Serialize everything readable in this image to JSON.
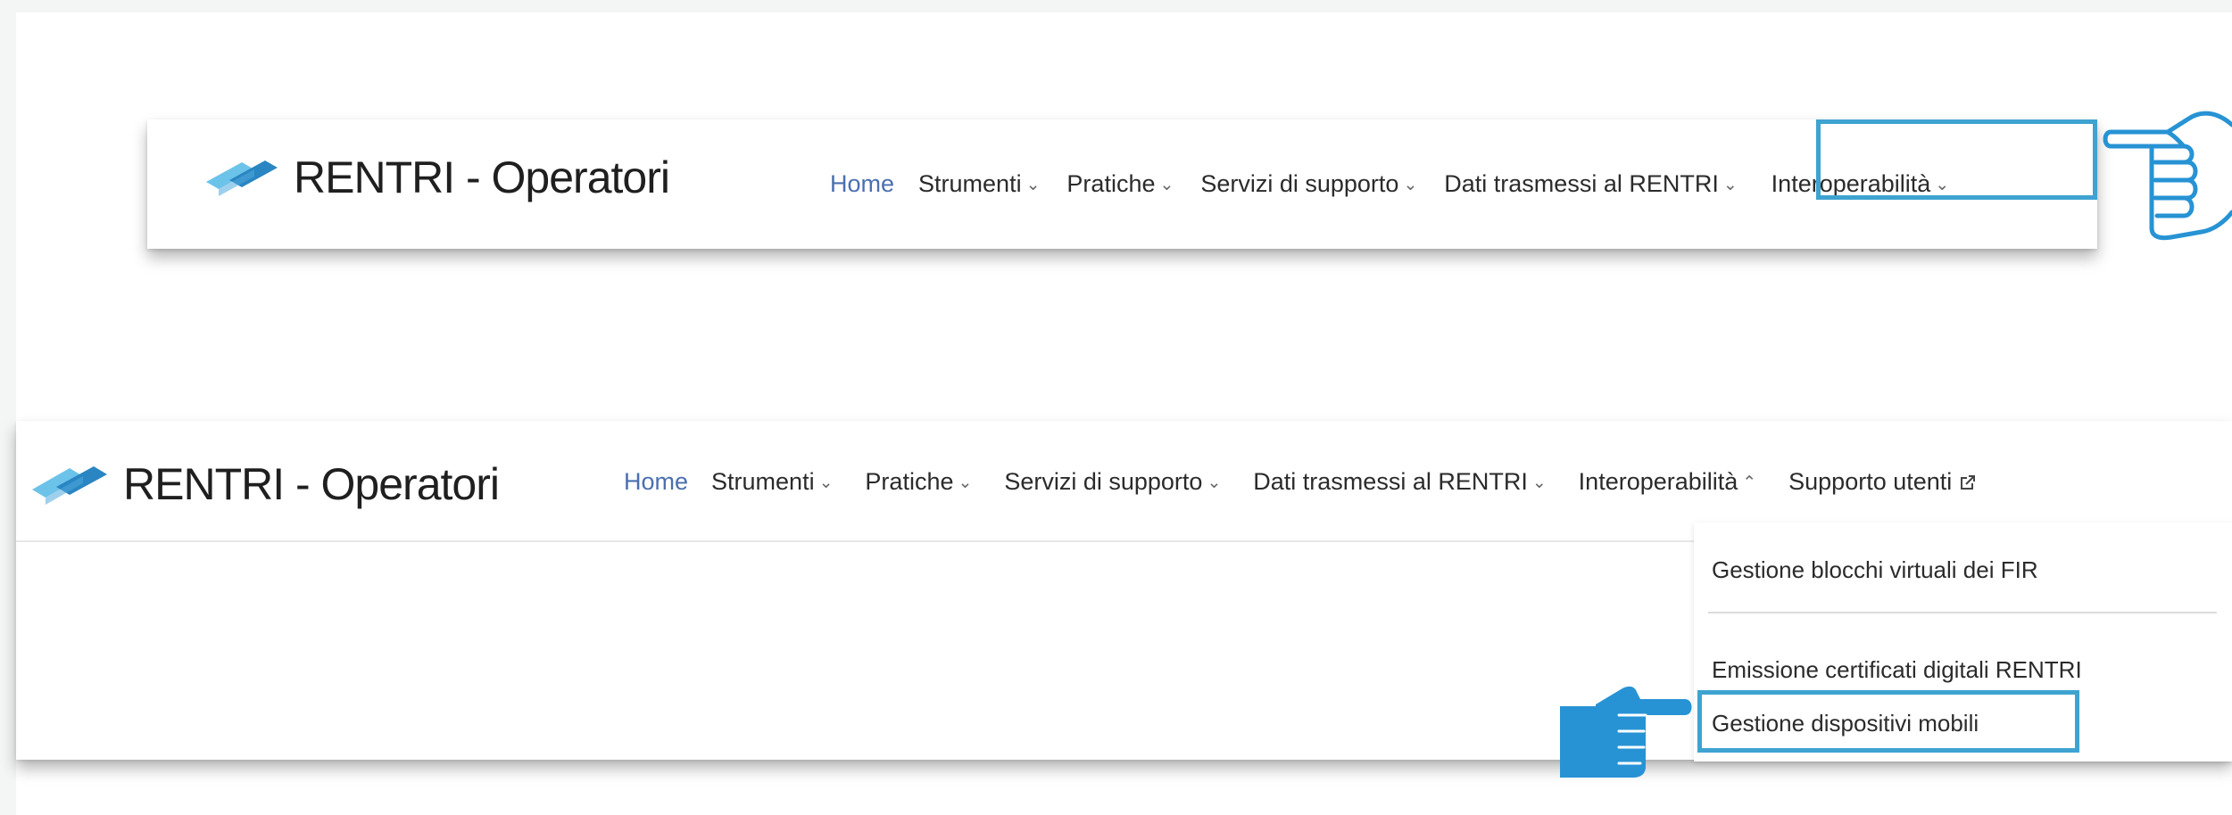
{
  "panel_top": {
    "brand": "RENTRI",
    "brand_suffix": " - Operatori",
    "nav": [
      {
        "label": "Home"
      },
      {
        "label": "Strumenti",
        "chevron": "chevron-down"
      },
      {
        "label": "Pratiche",
        "chevron": "chevron-down"
      },
      {
        "label": "Servizi di supporto",
        "chevron": "chevron-down"
      },
      {
        "label": "Dati trasmessi al RENTRI",
        "chevron": "chevron-down"
      },
      {
        "label": "Interoperabilità",
        "chevron": "chevron-down",
        "highlighted": true
      }
    ]
  },
  "panel_bottom": {
    "brand": "RENTRI",
    "brand_suffix": " - Operatori",
    "nav": [
      {
        "label": "Home"
      },
      {
        "label": "Strumenti",
        "chevron": "chevron-down"
      },
      {
        "label": "Pratiche",
        "chevron": "chevron-down"
      },
      {
        "label": "Servizi di supporto",
        "chevron": "chevron-down"
      },
      {
        "label": "Dati trasmessi al RENTRI",
        "chevron": "chevron-down"
      },
      {
        "label": "Interoperabilità",
        "chevron": "chevron-up",
        "open": true
      },
      {
        "label": "Supporto utenti",
        "icon": "external-link-icon"
      }
    ],
    "dropdown": [
      {
        "label": "Gestione blocchi virtuali dei FIR"
      },
      {
        "label": "Emissione certificati digitali RENTRI"
      },
      {
        "label": "Gestione dispositivi mobili",
        "highlighted": true
      }
    ]
  },
  "chevrons": {
    "down": "⌄",
    "up": "⌃"
  },
  "colors": {
    "highlight": "#3ea3d0",
    "logo_light": "#6cc3ea",
    "logo_dark": "#2a86c2",
    "home_link": "#4a6fb0",
    "hand_fill": "#2793d4"
  }
}
